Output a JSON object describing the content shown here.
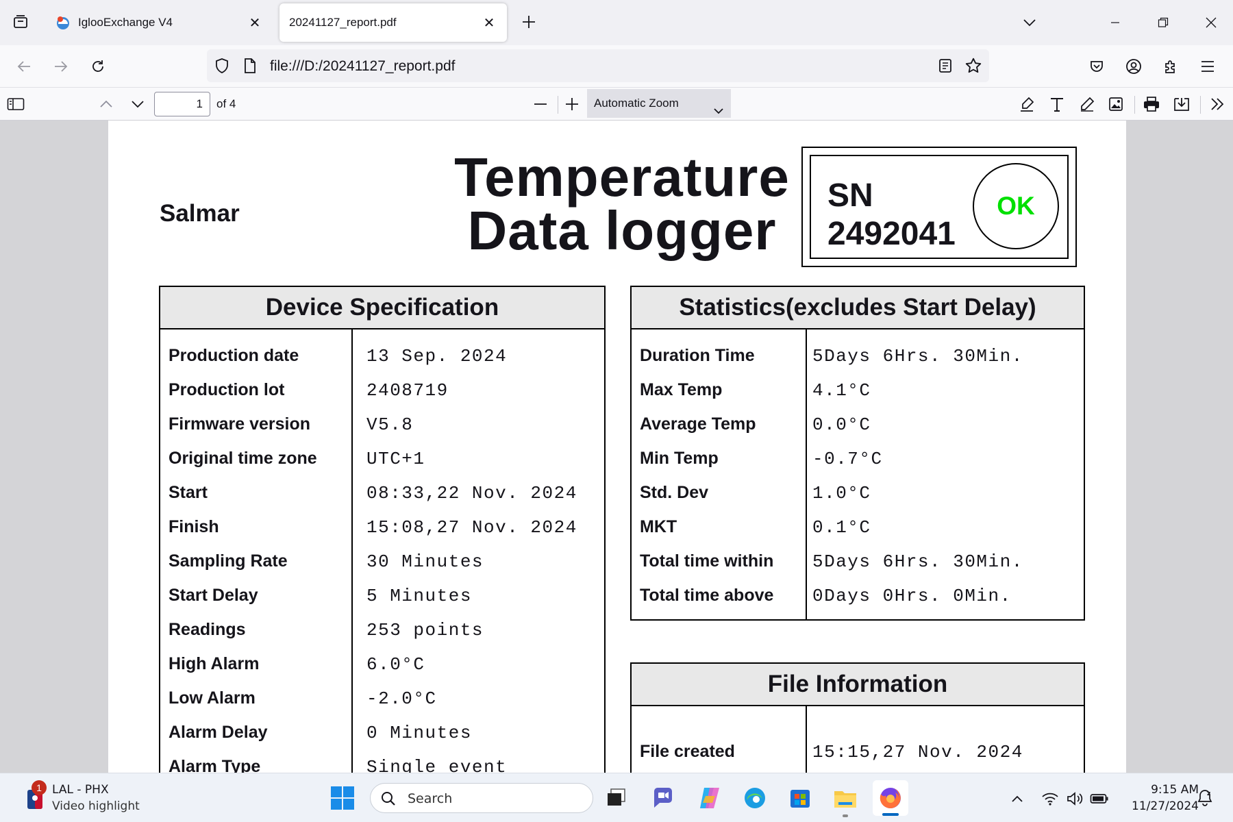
{
  "browser": {
    "tabs": [
      {
        "title": "IglooExchange V4",
        "active": false
      },
      {
        "title": "20241127_report.pdf",
        "active": true
      }
    ],
    "url": "file:///D:/20241127_report.pdf"
  },
  "pdf_toolbar": {
    "page_number": "1",
    "page_count": "of 4",
    "zoom": "Automatic Zoom"
  },
  "report": {
    "company": "Salmar",
    "title_line1": "Temperature",
    "title_line2": "Data logger",
    "sn_label": "SN",
    "sn_value": "2492041",
    "status": "OK",
    "status_color": "#00e000",
    "device_spec": {
      "heading": "Device Specification",
      "rows": [
        {
          "label": "Production date",
          "value": "13 Sep. 2024"
        },
        {
          "label": "Production lot",
          "value": "2408719"
        },
        {
          "label": "Firmware version",
          "value": "V5.8"
        },
        {
          "label": "Original time zone",
          "value": "UTC+1"
        },
        {
          "label": "Start",
          "value": "08:33,22 Nov. 2024"
        },
        {
          "label": "Finish",
          "value": "15:08,27 Nov. 2024"
        },
        {
          "label": "Sampling Rate",
          "value": "30 Minutes"
        },
        {
          "label": "Start Delay",
          "value": "5 Minutes"
        },
        {
          "label": "Readings",
          "value": "253 points"
        },
        {
          "label": "High Alarm",
          "value": "6.0°C"
        },
        {
          "label": "Low Alarm",
          "value": "-2.0°C"
        },
        {
          "label": "Alarm Delay",
          "value": "0 Minutes"
        },
        {
          "label": "Alarm Type",
          "value": "Single event"
        }
      ]
    },
    "statistics": {
      "heading": "Statistics(excludes Start Delay)",
      "rows": [
        {
          "label": "Duration Time",
          "value": "5Days 6Hrs. 30Min."
        },
        {
          "label": "Max Temp",
          "value": "4.1°C"
        },
        {
          "label": "Average Temp",
          "value": "0.0°C"
        },
        {
          "label": "Min Temp",
          "value": "-0.7°C"
        },
        {
          "label": "Std. Dev",
          "value": "1.0°C"
        },
        {
          "label": "MKT",
          "value": "0.1°C"
        },
        {
          "label": "Total time within",
          "value": "5Days 6Hrs. 30Min."
        },
        {
          "label": "Total time above",
          "value": "0Days 0Hrs. 0Min."
        }
      ]
    },
    "file_info": {
      "heading": "File Information",
      "rows": [
        {
          "label": "File created",
          "value": "15:15,27 Nov. 2024"
        }
      ]
    }
  },
  "taskbar": {
    "news_badge": "1",
    "news_title": "LAL - PHX",
    "news_subtitle": "Video highlight",
    "search_placeholder": "Search",
    "time": "9:15 AM",
    "date": "11/27/2024"
  }
}
